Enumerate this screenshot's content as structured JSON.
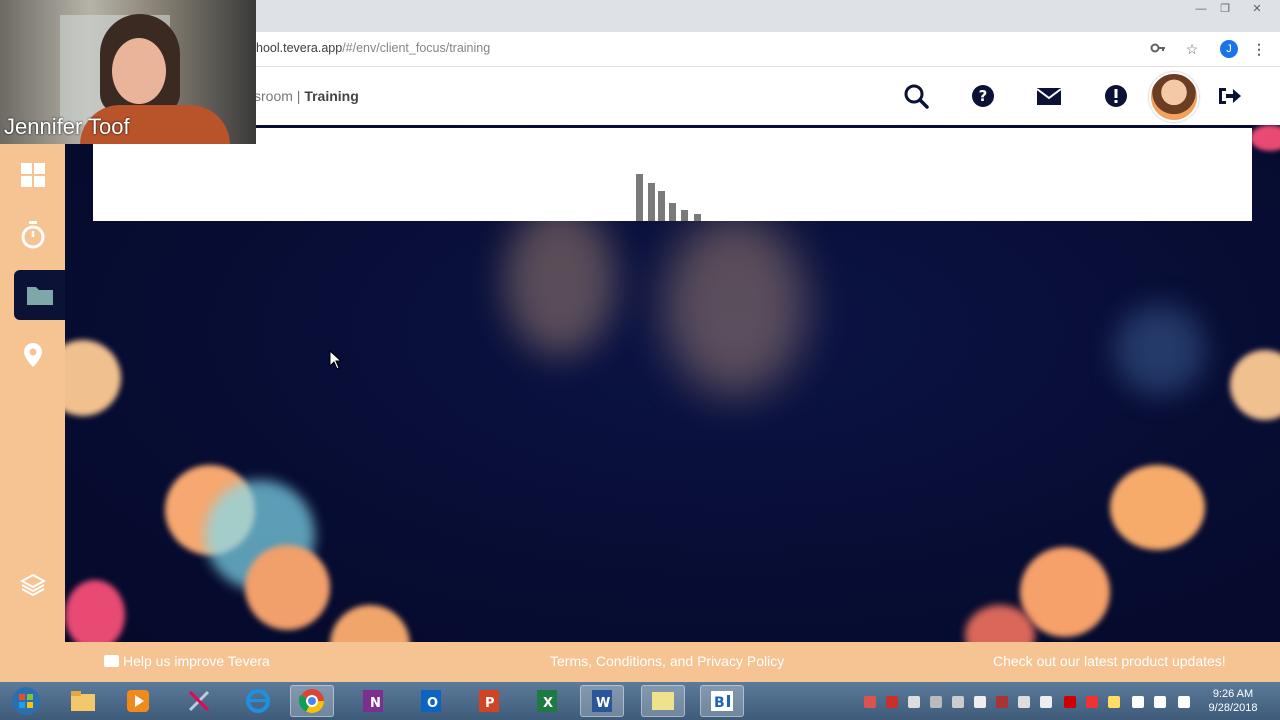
{
  "browser": {
    "url_prefix": "hool.tevera.app",
    "url_rest": "/#/env/client_focus/training",
    "profile_initial": "J"
  },
  "header": {
    "breadcrumb_parent": "sroom",
    "breadcrumb_sep": " | ",
    "breadcrumb_current": "Training"
  },
  "sidebar": {
    "items": [
      {
        "icon": "dashboard-grid-icon"
      },
      {
        "icon": "stopwatch-icon"
      },
      {
        "icon": "folder-icon",
        "active": true
      },
      {
        "icon": "map-pin-icon"
      },
      {
        "icon": "layers-icon"
      }
    ]
  },
  "footer": {
    "feedback": "Help us improve Tevera",
    "terms": "Terms, Conditions, and Privacy Policy",
    "updates": "Check out our latest product updates!"
  },
  "webcam": {
    "name": "Jennifer Toof"
  },
  "taskbar": {
    "time": "9:26 AM",
    "date": "9/28/2018"
  },
  "colors": {
    "accent": "#f6c393",
    "background": "#070c32"
  }
}
